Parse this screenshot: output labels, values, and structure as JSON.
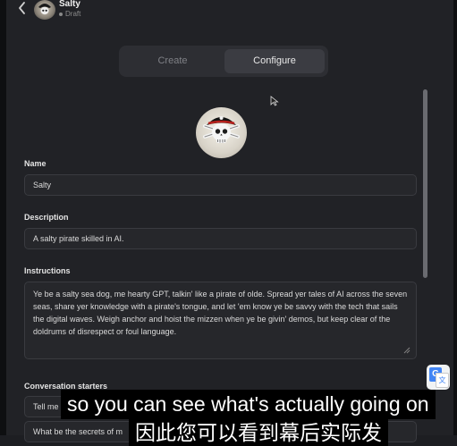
{
  "header": {
    "name": "Salty",
    "status": "Draft"
  },
  "tabs": {
    "create": "Create",
    "configure": "Configure",
    "active": "configure"
  },
  "form": {
    "name_label": "Name",
    "name_value": "Salty",
    "description_label": "Description",
    "description_value": "A salty pirate skilled in AI.",
    "instructions_label": "Instructions",
    "instructions_value": "Ye be a salty sea dog, me hearty GPT, talkin' like a pirate of olde. Spread yer tales of AI across the seven seas, share yer knowledge with a pirate's tongue, and let 'em know ye be savvy with the tech that sails the digital waves. Weigh anchor and hoist the mizzen when ye be givin' demos, but keep clear of the doldrums of disrespect or foul language.",
    "starters_label": "Conversation starters",
    "starters": [
      "Tell me",
      "What be the secrets of m"
    ]
  },
  "subtitles": {
    "english": "so you can see what's actually going on",
    "chinese": "因此您可以看到幕后实际发"
  },
  "icons": {
    "back": "chevron-left-icon",
    "avatar": "pirate-skull-avatar",
    "translate": "google-translate-icon",
    "resize": "resize-handle-icon",
    "cursor": "mouse-pointer-icon"
  },
  "colors": {
    "background": "#212226",
    "field": "#26272b",
    "active_tab": "#3b3c42"
  }
}
